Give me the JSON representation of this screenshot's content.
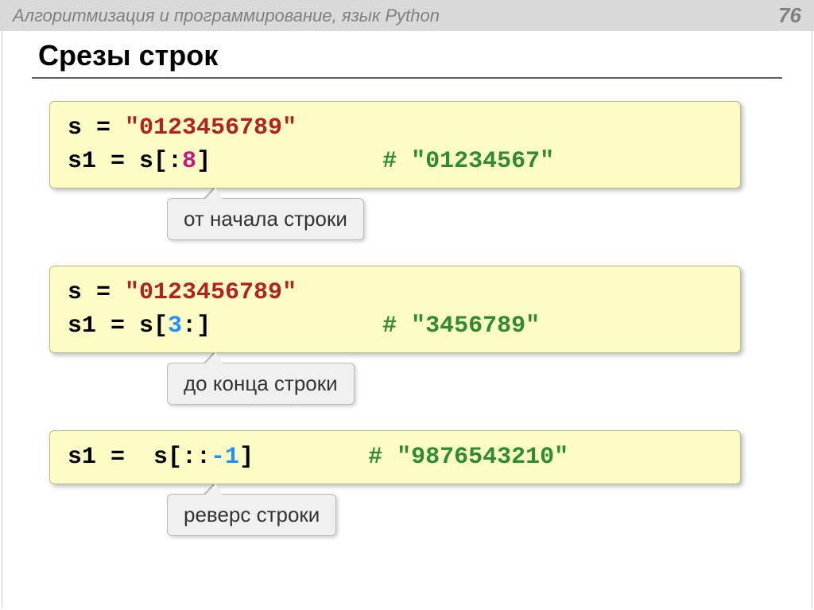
{
  "header": {
    "breadcrumb": "Алгоритмизация и программирование, язык Python",
    "page_number": "76"
  },
  "title": "Срезы строк",
  "blocks": [
    {
      "line1_var": "s",
      "line1_eq": " = ",
      "line1_str": "\"0123456789\"",
      "line2_var": "s1",
      "line2_eq": " = ",
      "line2_expr_a": "s[:",
      "line2_num": "8",
      "line2_expr_b": "]",
      "line2_pad": "            ",
      "line2_comment": "# \"01234567\"",
      "callout": "от начала строки"
    },
    {
      "line1_var": "s",
      "line1_eq": " = ",
      "line1_str": "\"0123456789\"",
      "line2_var": "s1",
      "line2_eq": " = ",
      "line2_expr_a": "s[",
      "line2_num": "3",
      "line2_expr_b": ":]",
      "line2_pad": "            ",
      "line2_comment": "# \"3456789\"",
      "callout": "до конца строки"
    },
    {
      "line_var": "s1",
      "line_eq": " = ",
      "line_expr_a": " s[::",
      "line_num": "-1",
      "line_expr_b": "]",
      "line_pad": "        ",
      "line_comment": "# \"9876543210\"",
      "callout": "реверс строки"
    }
  ]
}
